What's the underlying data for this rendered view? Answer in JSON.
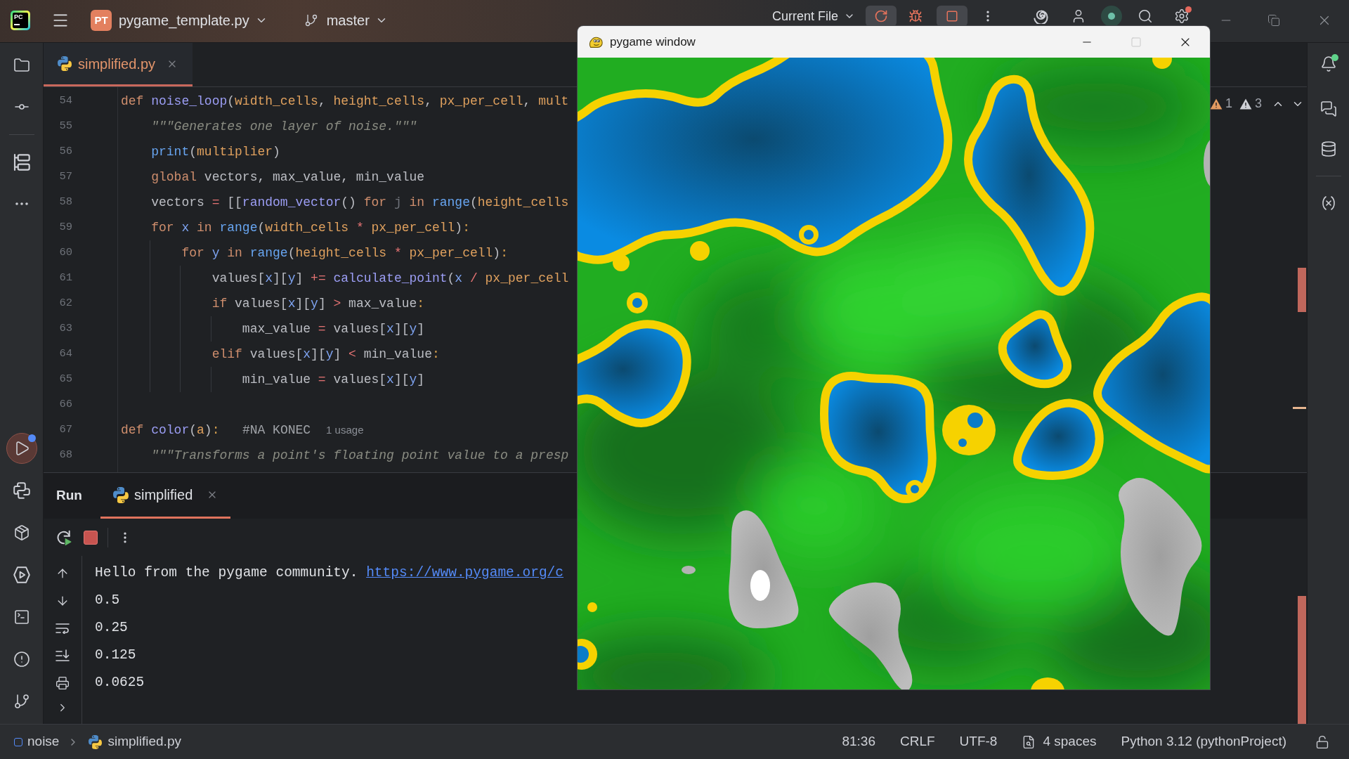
{
  "title_bar": {
    "logo": "PC",
    "project_badge": "PT",
    "project": "pygame_template.py",
    "branch": "master",
    "run_config": "Current File",
    "running": true,
    "settings_badge": true
  },
  "left_toolbar": {
    "top": [
      {
        "selected": false
      },
      {
        "selected": false
      },
      {
        "selected": false
      },
      {
        "selected": false
      }
    ],
    "bottom": [
      {
        "selected": true,
        "badge": true
      },
      {
        "selected": false,
        "badge": false
      },
      {
        "selected": false,
        "badge": false
      },
      {
        "selected": false,
        "badge": false
      },
      {
        "selected": false,
        "badge": false
      },
      {
        "selected": false,
        "badge": false
      },
      {
        "selected": false,
        "badge": false
      }
    ]
  },
  "editor": {
    "tabs": [
      {
        "label": "simplified.py",
        "selected": true
      }
    ],
    "inspections": [
      {
        "count": "1",
        "color": "#e39a61"
      },
      {
        "count": "3",
        "color": "#ced0d6"
      }
    ],
    "lines": [
      {
        "number": "54",
        "tokens": [
          {
            "text": "def ",
            "kind": "kw"
          },
          {
            "text": "noise_loop",
            "kind": "fn"
          },
          {
            "text": "(",
            "kind": "plain"
          },
          {
            "text": "width_cells",
            "kind": "param"
          },
          {
            "text": ", ",
            "kind": "plain"
          },
          {
            "text": "height_cells",
            "kind": "param"
          },
          {
            "text": ", ",
            "kind": "plain"
          },
          {
            "text": "px_per_cell",
            "kind": "param"
          },
          {
            "text": ", ",
            "kind": "plain"
          },
          {
            "text": "mult",
            "kind": "param"
          }
        ]
      },
      {
        "number": "55",
        "tokens": [
          {
            "text": "    \"\"\"Generates one layer of noise.\"\"\"",
            "kind": "doc"
          }
        ]
      },
      {
        "number": "56",
        "tokens": [
          {
            "text": "    print",
            "kind": "builtin"
          },
          {
            "text": "(",
            "kind": "plain"
          },
          {
            "text": "multiplier",
            "kind": "param"
          },
          {
            "text": ")",
            "kind": "plain"
          }
        ]
      },
      {
        "number": "57",
        "tokens": [
          {
            "text": "    global",
            "kind": "kw"
          },
          {
            "text": " vectors, max_value, min_value",
            "kind": "plain"
          }
        ]
      },
      {
        "number": "58",
        "tokens": [
          {
            "text": "    vectors ",
            "kind": "plain"
          },
          {
            "text": "=",
            "kind": "op"
          },
          {
            "text": " [[",
            "kind": "plain"
          },
          {
            "text": "random_vector",
            "kind": "fn"
          },
          {
            "text": "() ",
            "kind": "plain"
          },
          {
            "text": "for ",
            "kind": "kw"
          },
          {
            "text": "j ",
            "kind": "unused"
          },
          {
            "text": "in ",
            "kind": "kw"
          },
          {
            "text": "range",
            "kind": "builtin"
          },
          {
            "text": "(",
            "kind": "plain"
          },
          {
            "text": "height_cells",
            "kind": "param"
          }
        ]
      },
      {
        "number": "59",
        "tokens": [
          {
            "text": "    for ",
            "kind": "kw"
          },
          {
            "text": "x ",
            "kind": "var"
          },
          {
            "text": "in ",
            "kind": "kw"
          },
          {
            "text": "range",
            "kind": "builtin"
          },
          {
            "text": "(",
            "kind": "plain"
          },
          {
            "text": "width_cells ",
            "kind": "param"
          },
          {
            "text": "*",
            "kind": "op"
          },
          {
            "text": " px_per_cell",
            "kind": "param"
          },
          {
            "text": ")",
            "kind": "plain"
          },
          {
            "text": ":",
            "kind": "colon"
          }
        ]
      },
      {
        "number": "60",
        "tokens": [
          {
            "text": "        for ",
            "kind": "kw"
          },
          {
            "text": "y ",
            "kind": "var"
          },
          {
            "text": "in ",
            "kind": "kw"
          },
          {
            "text": "range",
            "kind": "builtin"
          },
          {
            "text": "(",
            "kind": "plain"
          },
          {
            "text": "height_cells ",
            "kind": "param"
          },
          {
            "text": "*",
            "kind": "op"
          },
          {
            "text": " px_per_cell",
            "kind": "param"
          },
          {
            "text": ")",
            "kind": "plain"
          },
          {
            "text": ":",
            "kind": "colon"
          }
        ]
      },
      {
        "number": "61",
        "tokens": [
          {
            "text": "            values[",
            "kind": "plain"
          },
          {
            "text": "x",
            "kind": "var"
          },
          {
            "text": "][",
            "kind": "plain"
          },
          {
            "text": "y",
            "kind": "var"
          },
          {
            "text": "] ",
            "kind": "plain"
          },
          {
            "text": "+=",
            "kind": "op"
          },
          {
            "text": " calculate_point",
            "kind": "fn"
          },
          {
            "text": "(",
            "kind": "plain"
          },
          {
            "text": "x ",
            "kind": "var"
          },
          {
            "text": "/",
            "kind": "op"
          },
          {
            "text": " px_per_cell",
            "kind": "param"
          }
        ]
      },
      {
        "number": "62",
        "tokens": [
          {
            "text": "            if",
            "kind": "kw"
          },
          {
            "text": " values[",
            "kind": "plain"
          },
          {
            "text": "x",
            "kind": "var"
          },
          {
            "text": "][",
            "kind": "plain"
          },
          {
            "text": "y",
            "kind": "var"
          },
          {
            "text": "] ",
            "kind": "plain"
          },
          {
            "text": ">",
            "kind": "op"
          },
          {
            "text": " max_value",
            "kind": "plain"
          },
          {
            "text": ":",
            "kind": "colon"
          }
        ]
      },
      {
        "number": "63",
        "tokens": [
          {
            "text": "                max_value ",
            "kind": "plain"
          },
          {
            "text": "=",
            "kind": "op"
          },
          {
            "text": " values[",
            "kind": "plain"
          },
          {
            "text": "x",
            "kind": "var"
          },
          {
            "text": "][",
            "kind": "plain"
          },
          {
            "text": "y",
            "kind": "var"
          },
          {
            "text": "]",
            "kind": "plain"
          }
        ]
      },
      {
        "number": "64",
        "tokens": [
          {
            "text": "            elif",
            "kind": "kw"
          },
          {
            "text": " values[",
            "kind": "plain"
          },
          {
            "text": "x",
            "kind": "var"
          },
          {
            "text": "][",
            "kind": "plain"
          },
          {
            "text": "y",
            "kind": "var"
          },
          {
            "text": "] ",
            "kind": "plain"
          },
          {
            "text": "<",
            "kind": "op"
          },
          {
            "text": " min_value",
            "kind": "plain"
          },
          {
            "text": ":",
            "kind": "colon"
          }
        ]
      },
      {
        "number": "65",
        "tokens": [
          {
            "text": "                min_value ",
            "kind": "plain"
          },
          {
            "text": "=",
            "kind": "op"
          },
          {
            "text": " values[",
            "kind": "plain"
          },
          {
            "text": "x",
            "kind": "var"
          },
          {
            "text": "][",
            "kind": "plain"
          },
          {
            "text": "y",
            "kind": "var"
          },
          {
            "text": "]",
            "kind": "plain"
          }
        ]
      },
      {
        "number": "66"
      },
      {
        "number": "67",
        "tokens": [
          {
            "text": "def ",
            "kind": "kw"
          },
          {
            "text": "color",
            "kind": "fn"
          },
          {
            "text": "(",
            "kind": "plain"
          },
          {
            "text": "a",
            "kind": "param"
          },
          {
            "text": ")",
            "kind": "plain"
          },
          {
            "text": ":",
            "kind": "colon"
          },
          {
            "text": "   #NA KONEC",
            "kind": "comment"
          }
        ],
        "hint": "1 usage"
      },
      {
        "number": "68",
        "tokens": [
          {
            "text": "    \"\"\"Transforms a point's floating point value to a presp",
            "kind": "doc"
          }
        ]
      }
    ]
  },
  "run_panel": {
    "title": "Run",
    "tabs": [
      {
        "label": "simplified",
        "selected": true
      }
    ],
    "running": true,
    "output": [
      {
        "text": "Hello from the pygame community.",
        "link": "https://www.pygame.org/c"
      },
      {
        "text": "0.5"
      },
      {
        "text": "0.25"
      },
      {
        "text": "0.125"
      },
      {
        "text": "0.0625"
      }
    ]
  },
  "right_toolbar": [
    {
      "badge": true
    },
    {
      "badge": false
    },
    {
      "badge": false
    },
    {
      "badge": false
    }
  ],
  "status_bar": {
    "breadcrumbs": [
      "noise",
      "simplified.py"
    ],
    "position": "81:36",
    "line_separator": "CRLF",
    "encoding": "UTF-8",
    "indent": "4 spaces",
    "interpreter": "Python 3.12 (pythonProject)"
  },
  "pygame_window": {
    "title": "pygame window",
    "maximize_disabled": true
  }
}
